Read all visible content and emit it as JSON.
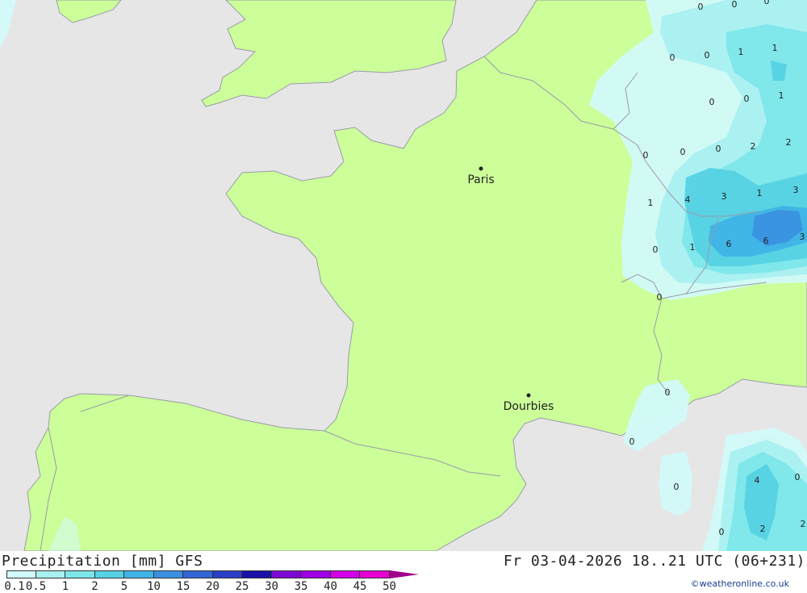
{
  "map": {
    "cities": [
      {
        "name": "Paris"
      },
      {
        "name": "Dourbies"
      }
    ],
    "values": [
      "0",
      "0",
      "0",
      "0",
      "1",
      "1",
      "0",
      "0",
      "1",
      "0",
      "0",
      "0",
      "2",
      "2",
      "0",
      "1",
      "4",
      "3",
      "1",
      "3",
      "0",
      "1",
      "6",
      "6",
      "3",
      "0",
      "0",
      "0",
      "0",
      "4",
      "0",
      "0",
      "2",
      "2"
    ]
  },
  "legend": {
    "title": "Precipitation [mm] GFS",
    "run_info": "Fr 03-04-2026 18..21 UTC (06+231)",
    "credit": "©weatheronline.co.uk",
    "ticks": [
      "0.1",
      "0.5",
      "1",
      "2",
      "5",
      "10",
      "15",
      "20",
      "25",
      "30",
      "35",
      "40",
      "45",
      "50"
    ],
    "colors": [
      "#d2fafa",
      "#a9f0f0",
      "#7de6ea",
      "#55d2e4",
      "#3fb4e6",
      "#3a90e0",
      "#3266d6",
      "#2a3fc8",
      "#1a12a8",
      "#7d0ad4",
      "#a000e6",
      "#d400e8",
      "#e600d2",
      "#a0008c"
    ]
  }
}
